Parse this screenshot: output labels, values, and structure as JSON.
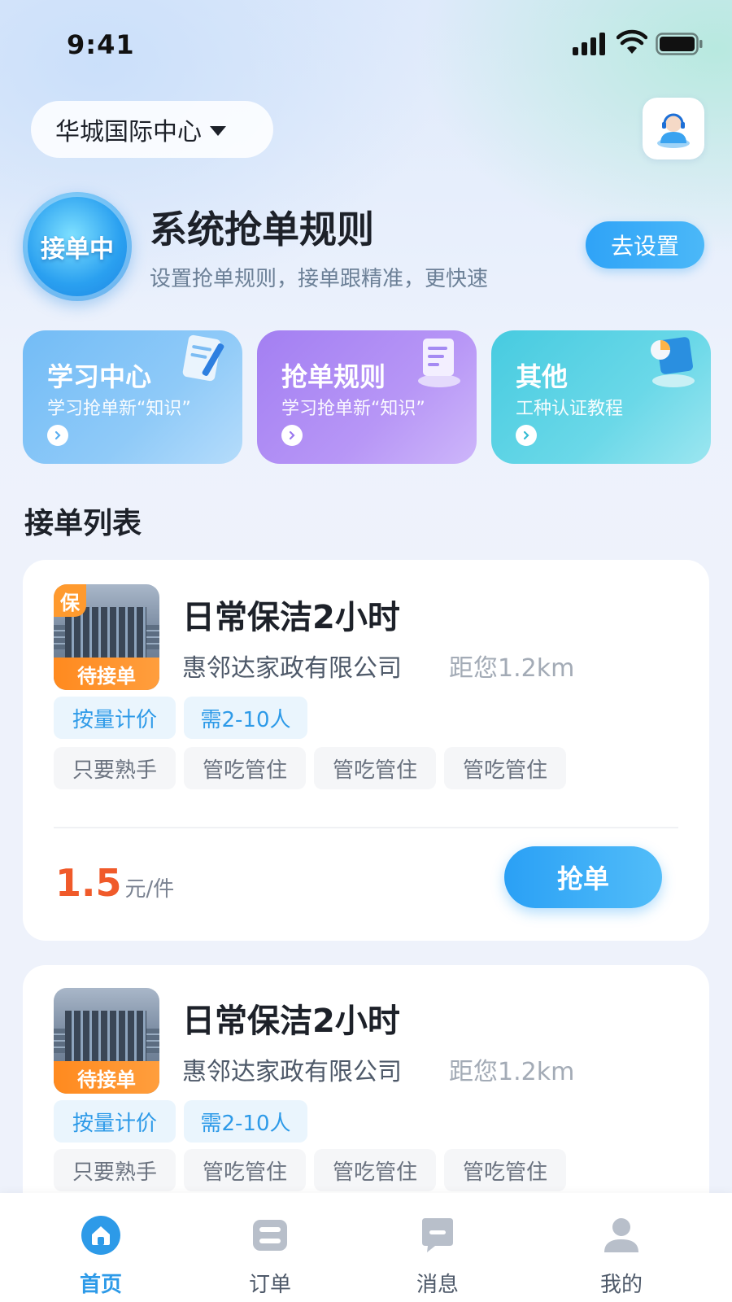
{
  "status_bar": {
    "time": "9:41"
  },
  "header": {
    "location": "华城国际中心"
  },
  "rule_banner": {
    "badge": "接单中",
    "title": "系统抢单规则",
    "subtitle": "设置抢单规则，接单跟精准，更快速",
    "button": "去设置"
  },
  "features": [
    {
      "title": "学习中心",
      "subtitle": "学习抢单新“知识”"
    },
    {
      "title": "抢单规则",
      "subtitle": "学习抢单新“知识”"
    },
    {
      "title": "其他",
      "subtitle": "工种认证教程"
    }
  ],
  "section_title": "接单列表",
  "orders": [
    {
      "tag": "保",
      "status": "待接单",
      "title": "日常保洁2小时",
      "company": "惠邻达家政有限公司",
      "distance": "距您1.2km",
      "primary_tags": [
        "按量计价",
        "需2-10人"
      ],
      "secondary_tags": [
        "只要熟手",
        "管吃管住",
        "管吃管住",
        "管吃管住"
      ],
      "price": "1.5",
      "price_unit": "元/件",
      "action": "抢单"
    },
    {
      "status": "待接单",
      "title": "日常保洁2小时",
      "company": "惠邻达家政有限公司",
      "distance": "距您1.2km",
      "primary_tags": [
        "按量计价",
        "需2-10人"
      ],
      "secondary_tags": [
        "只要熟手",
        "管吃管住",
        "管吃管住",
        "管吃管住"
      ]
    }
  ],
  "tabbar": [
    {
      "label": "首页",
      "icon": "home-icon",
      "active": true
    },
    {
      "label": "订单",
      "icon": "order-icon",
      "active": false
    },
    {
      "label": "消息",
      "icon": "message-icon",
      "active": false
    },
    {
      "label": "我的",
      "icon": "profile-icon",
      "active": false
    }
  ],
  "colors": {
    "accent": "#2d9ae8",
    "price": "#f05a2a",
    "status_orange": "#ff8a1f"
  }
}
